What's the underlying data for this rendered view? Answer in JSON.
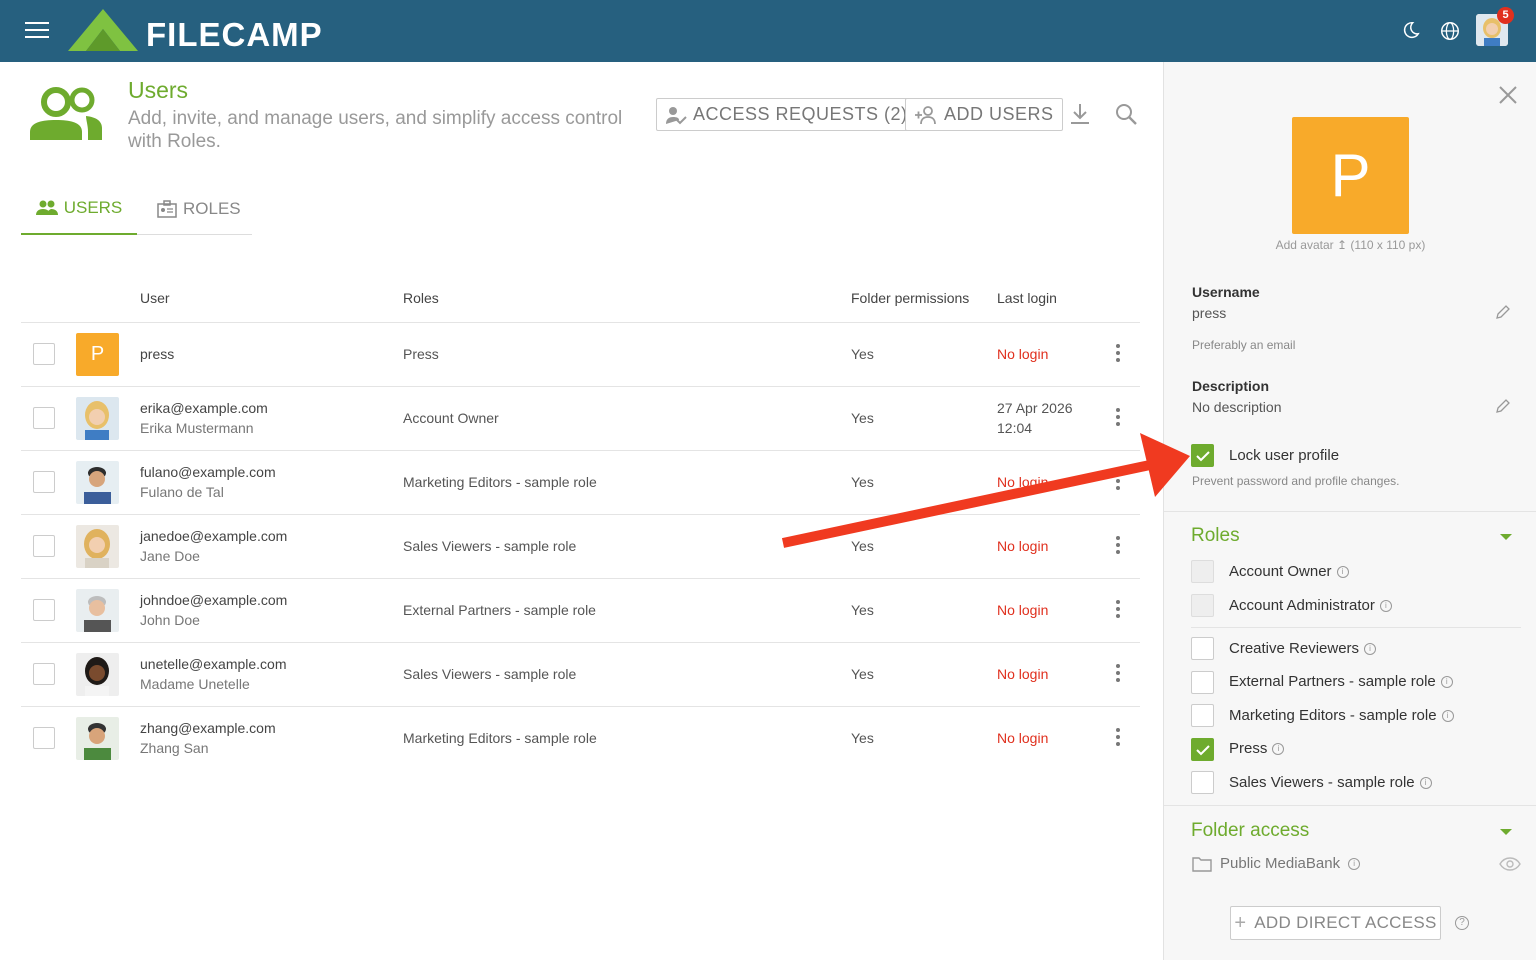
{
  "topbar": {
    "logo_text": "FILECAMP",
    "notification_count": "5",
    "icons": [
      "menu-icon",
      "moon-icon",
      "globe-icon",
      "user-avatar"
    ]
  },
  "header": {
    "title": "Users",
    "subtitle": "Add, invite, and manage users, and simplify access control with Roles.",
    "access_requests_label": "ACCESS REQUESTS (2)",
    "add_users_label": "ADD USERS"
  },
  "tabs": [
    {
      "label": "USERS",
      "active": true
    },
    {
      "label": "ROLES",
      "active": false
    }
  ],
  "table": {
    "columns": [
      "User",
      "Roles",
      "Folder permissions",
      "Last login"
    ],
    "rows": [
      {
        "avatar": "P",
        "line1": "press",
        "line2": "",
        "roles": "Press",
        "folder": "Yes",
        "last1": "No login",
        "last2": ""
      },
      {
        "avatar": "photo",
        "line1": "erika@example.com",
        "line2": "Erika Mustermann",
        "roles": "Account Owner",
        "folder": "Yes",
        "last1": "27 Apr 2026",
        "last2": "12:04"
      },
      {
        "avatar": "photo",
        "line1": "fulano@example.com",
        "line2": "Fulano de Tal",
        "roles": "Marketing Editors - sample role",
        "folder": "Yes",
        "last1": "No login",
        "last2": ""
      },
      {
        "avatar": "photo",
        "line1": "janedoe@example.com",
        "line2": "Jane Doe",
        "roles": "Sales Viewers - sample role",
        "folder": "Yes",
        "last1": "No login",
        "last2": ""
      },
      {
        "avatar": "photo",
        "line1": "johndoe@example.com",
        "line2": "John Doe",
        "roles": "External Partners - sample role",
        "folder": "Yes",
        "last1": "No login",
        "last2": ""
      },
      {
        "avatar": "photo",
        "line1": "unetelle@example.com",
        "line2": "Madame Unetelle",
        "roles": "Sales Viewers - sample role",
        "folder": "Yes",
        "last1": "No login",
        "last2": ""
      },
      {
        "avatar": "photo",
        "line1": "zhang@example.com",
        "line2": "Zhang San",
        "roles": "Marketing Editors - sample role",
        "folder": "Yes",
        "last1": "No login",
        "last2": ""
      }
    ]
  },
  "panel": {
    "avatar_letter": "P",
    "add_avatar": "Add avatar",
    "avatar_size": "(110 x 110 px)",
    "username_label": "Username",
    "username_value": "press",
    "username_hint": "Preferably an email",
    "description_label": "Description",
    "description_value": "No description",
    "lock_label": "Lock user profile",
    "lock_checked": true,
    "lock_hint": "Prevent password and profile changes.",
    "roles_title": "Roles",
    "roles_admin": [
      {
        "label": "Account Owner",
        "checked": false
      },
      {
        "label": "Account Administrator",
        "checked": false
      }
    ],
    "roles": [
      {
        "label": "Creative Reviewers",
        "checked": false
      },
      {
        "label": "External Partners - sample role",
        "checked": false
      },
      {
        "label": "Marketing Editors - sample role",
        "checked": false
      },
      {
        "label": "Press",
        "checked": true
      },
      {
        "label": "Sales Viewers - sample role",
        "checked": false
      }
    ],
    "folder_title": "Folder access",
    "folder_item": "Public MediaBank",
    "add_direct_label": "ADD DIRECT ACCESS"
  },
  "colors": {
    "brand_green": "#6eab2e",
    "topbar": "#26607f",
    "error_red": "#e0301e",
    "avatar_orange": "#f8aa2a",
    "arrow_red": "#f03a20"
  }
}
